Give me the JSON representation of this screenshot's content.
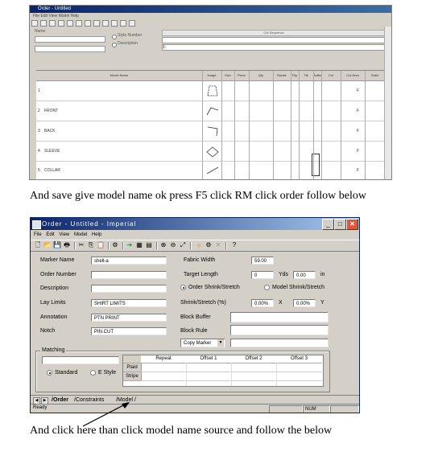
{
  "top_screenshot": {
    "title": "Order - Untitled",
    "menu": "File Edit View Model Help",
    "form_labels": {
      "name": "Name",
      "radio_1": "Style Number",
      "radio_2": "Description"
    },
    "form_inputs": {
      "header_right": "Cut Sequence",
      "marker_value": "1:"
    },
    "grid": {
      "headers": [
        "Model Name",
        "Image",
        "Size",
        "Piece",
        "Qty",
        "Rotate",
        "Flip",
        "Tilt",
        "Buffer",
        "Cut",
        "Cut Area",
        "Grain"
      ],
      "rows": [
        {
          "num": "1",
          "name": "",
          "size": "",
          "dots": "",
          "flag": "F"
        },
        {
          "num": "2",
          "name": "FRONT",
          "size": "",
          "dots": "",
          "flag": "F"
        },
        {
          "num": "3",
          "name": "BACK",
          "size": "",
          "dots": "",
          "flag": "F"
        },
        {
          "num": "4",
          "name": "SLEEVE",
          "size": "",
          "dots": "",
          "flag": "F"
        },
        {
          "num": "5",
          "name": "COLLAR",
          "size": "",
          "dots": "",
          "flag": "F"
        }
      ]
    }
  },
  "caption_1": "And save give model name ok press F5 click RM click order follow below",
  "caption_2": "And click here   than click model name source and follow the below",
  "order_window": {
    "title": "Order - Untitled - Imperial",
    "controls": {
      "minimize": "_",
      "maximize": "□",
      "close": "✕"
    },
    "menu": [
      "File",
      "Edit",
      "View",
      "Model",
      "Help"
    ],
    "toolbar_icons": [
      "new-icon",
      "open-icon",
      "save-icon",
      "print-icon",
      "cut-icon",
      "copy-icon",
      "paste-icon",
      "model-icon",
      "run-icon",
      "grid-icon",
      "view-icon",
      "zoom-in-icon",
      "zoom-out-icon",
      "info-icon",
      "help-icon"
    ],
    "fields": {
      "marker_name_label": "Marker Name",
      "marker_name_value": "shell-a",
      "order_number_label": "Order Number",
      "order_number_value": "",
      "description_label": "Description",
      "description_value": "",
      "lay_limits_label": "Lay Limits",
      "lay_limits_value": "SHIRT LIMITS",
      "annotation_label": "Annotation",
      "annotation_value": "PTN PRINT",
      "notch_label": "Notch",
      "notch_value": "PIN.CUT",
      "fabric_width_label": "Fabric Width",
      "fabric_width_value": "59.00",
      "target_length_label": "Target Length",
      "target_length_yds": "0",
      "yds_label": "Yds",
      "target_length_in": "0.00",
      "in_label": "in",
      "radio_order_label": "Order Shrink/Stretch",
      "radio_model_label": "Model Shrink/Stretch",
      "shrink_label": "Shrink/Stretch (%)",
      "shrink_x": "0.00%",
      "x_label": "X",
      "shrink_y": "0.00%",
      "y_label": "Y",
      "block_buffer_label": "Block Buffer",
      "block_buffer_value": "",
      "block_label": "Block Rule",
      "block_value": "",
      "copy_marker_label": "Copy Marker",
      "copy_marker_value": ""
    },
    "matching": {
      "group_label": "Matching",
      "input_value": "",
      "radio_standard": "Standard",
      "radio_other": "E Style",
      "table_headers": [
        "Repeat",
        "Offset 1",
        "Offset 2",
        "Offset 3"
      ],
      "row_labels": [
        "Plaid",
        "Stripe"
      ]
    },
    "tabs": [
      "Order",
      "Constraints",
      "Model"
    ],
    "status": {
      "ready": "Ready",
      "num": "NUM"
    }
  }
}
